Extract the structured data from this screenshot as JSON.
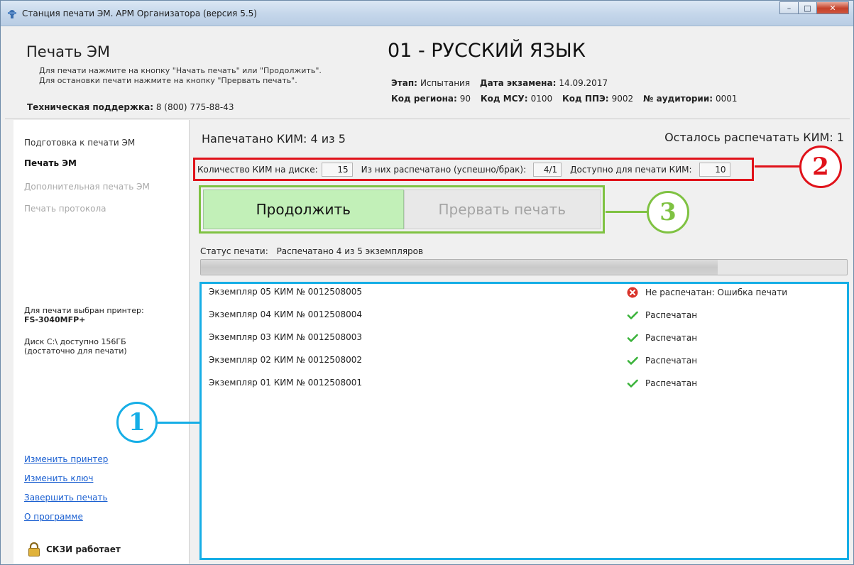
{
  "window": {
    "title": "Станция печати ЭМ. АРМ Организатора (версия 5.5)",
    "controls": {
      "minimize": "–",
      "maximize": "□",
      "close": "✕"
    }
  },
  "header": {
    "title": "Печать ЭМ",
    "hint_line1": "Для печати нажмите на кнопку \"Начать печать\" или \"Продолжить\".",
    "hint_line2": "Для остановки печати нажмите на кнопку \"Прервать печать\".",
    "support_label": "Техническая поддержка:",
    "support_phone": "8 (800) 775-88-43",
    "subject": "01 - РУССКИЙ ЯЗЫК",
    "stage_label": "Этап:",
    "stage_value": "Испытания",
    "exam_date_label": "Дата экзамена:",
    "exam_date_value": "14.09.2017",
    "region_label": "Код региона:",
    "region_value": "90",
    "msu_label": "Код МСУ:",
    "msu_value": "0100",
    "ppe_label": "Код ППЭ:",
    "ppe_value": "9002",
    "room_label": "№ аудитории:",
    "room_value": "0001"
  },
  "sidebar": {
    "items": [
      {
        "label": "Подготовка к печати ЭМ",
        "state": "normal"
      },
      {
        "label": "Печать ЭМ",
        "state": "active"
      },
      {
        "label": "Дополнительная печать ЭМ",
        "state": "disabled"
      },
      {
        "label": "Печать протокола",
        "state": "disabled"
      }
    ],
    "printer_label": "Для печати выбран принтер:",
    "printer_name": "FS-3040MFP+",
    "disk_line1": "Диск C:\\ доступно 156ГБ",
    "disk_line2": "(достаточно для печати)",
    "links": [
      "Изменить принтер",
      "Изменить ключ",
      "Завершить печать",
      "О программе"
    ],
    "skzi_status": "СКЗИ работает"
  },
  "main": {
    "printed_label": "Напечатано КИМ: 4 из 5",
    "remaining_label": "Осталось распечатать КИМ: 1",
    "counters": {
      "on_disk_label": "Количество КИМ на диске:",
      "on_disk_value": "15",
      "printed_label": "Из них распечатано (успешно/брак):",
      "printed_value": "4/1",
      "available_label": "Доступно для печати КИМ:",
      "available_value": "10"
    },
    "buttons": {
      "continue": "Продолжить",
      "abort": "Прервать печать"
    },
    "status_label": "Статус печати:",
    "status_value": "Распечатано 4 из 5 экземпляров",
    "progress_fraction": 0.8,
    "copies": [
      {
        "name": "Экземпляр 05  КИМ № 0012508005",
        "status": "Не распечатан: Ошибка печати",
        "icon": "error-icon"
      },
      {
        "name": "Экземпляр 04  КИМ № 0012508004",
        "status": "Распечатан",
        "icon": "check-icon"
      },
      {
        "name": "Экземпляр 03  КИМ № 0012508003",
        "status": "Распечатан",
        "icon": "check-icon"
      },
      {
        "name": "Экземпляр 02  КИМ № 0012508002",
        "status": "Распечатан",
        "icon": "check-icon"
      },
      {
        "name": "Экземпляр 01  КИМ № 0012508001",
        "status": "Распечатан",
        "icon": "check-icon"
      }
    ]
  },
  "callouts": [
    "1",
    "2",
    "3"
  ],
  "colors": {
    "callout_1": "#16aee6",
    "callout_2": "#e0121a",
    "callout_3": "#7fc242",
    "continue_button": "#c2f0b8",
    "link": "#1a5fd1",
    "error": "#d9342b",
    "success": "#3bb33b"
  }
}
